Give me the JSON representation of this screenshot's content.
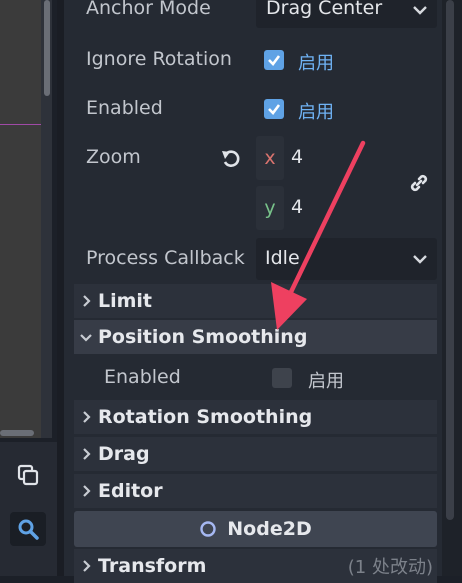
{
  "inspector": {
    "properties": {
      "anchor_mode": {
        "label": "Anchor Mode",
        "value": "Drag Center"
      },
      "ignore_rotation": {
        "label": "Ignore Rotation",
        "checked": true,
        "state_text": "启用"
      },
      "enabled": {
        "label": "Enabled",
        "checked": true,
        "state_text": "启用"
      },
      "zoom": {
        "label": "Zoom",
        "x_label": "x",
        "x_value": "4",
        "y_label": "y",
        "y_value": "4"
      },
      "process_callback": {
        "label": "Process Callback",
        "value": "Idle"
      }
    },
    "sections": {
      "limit": "Limit",
      "position_smoothing": "Position Smoothing",
      "rotation_smoothing": "Rotation Smoothing",
      "drag": "Drag",
      "editor": "Editor"
    },
    "position_smoothing_enabled": {
      "label": "Enabled",
      "checked": false,
      "state_text": "启用"
    },
    "class_header": {
      "name": "Node2D"
    },
    "transform": {
      "label": "Transform",
      "changes": "(1 处改动)"
    }
  },
  "colors": {
    "accent": "#5fa2e5",
    "arrow": "#ee4060",
    "x_axis": "#d9736e",
    "y_axis": "#78c28a"
  },
  "icons": {
    "revert": "revert-icon",
    "link": "link-icon",
    "copy": "copy-icon",
    "search": "search-icon",
    "node2d": "node2d-circle-icon"
  }
}
